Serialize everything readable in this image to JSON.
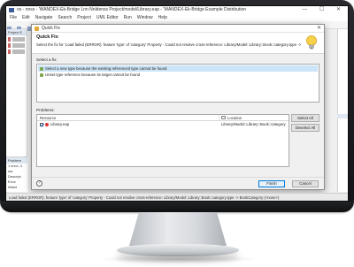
{
  "window": {
    "title": "os - nnss - 'WANDEX-Ek-Bridge Lnn Nnldenss Project/model/Library.eap - 'WANDEX-Ek-Bridge Example Distribution",
    "controls": "— ☐ ✕"
  },
  "menu": [
    "File",
    "Edit",
    "Navigate",
    "Search",
    "Project",
    "UML Editor",
    "Run",
    "Window",
    "Help"
  ],
  "left_panel": {
    "tab_label": "Project E"
  },
  "bottom_panel": {
    "tab_label": "Problem",
    "count_text": "1 error, 4 wa",
    "desc_label": "Descript",
    "row1": "Error",
    "row2": "Warni"
  },
  "dialog": {
    "title": "Quick Fix",
    "heading": "Quick Fix",
    "message": "Select the fix for 'Load failed (ERROR): feature 'type' of 'category' Property - Could not resolve cross-reference: Library/Model::Library::Book::category.type -> BookCategory (<none>)'",
    "select_fix_label": "Select a fix:",
    "fixes": [
      {
        "label": "Select a new type because the existing referenced type cannot be found",
        "selected": true
      },
      {
        "label": "Unset type reference because its target cannot be found",
        "selected": false
      }
    ],
    "problems_label": "Problems:",
    "problems_table": {
      "columns": {
        "resource": "Resource",
        "location": "Location"
      },
      "rows": [
        {
          "resource": "Library.eap",
          "location": "Library/Model::Library::Book::category",
          "checked": true
        }
      ]
    },
    "buttons": {
      "select_all": "Select All",
      "deselect_all": "Deselect All",
      "finish": "Finish",
      "cancel": "Cancel",
      "help": "?"
    }
  },
  "statusbar": {
    "text": "Load failed (ERROR): feature 'type' of 'category' Property - Could not resolve cross-reference: Library/Model::Library::Book::category.type -> BookCategory (<none>)"
  }
}
